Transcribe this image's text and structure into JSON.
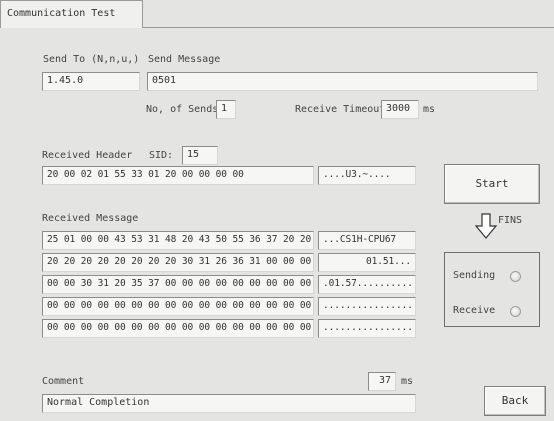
{
  "tab": {
    "label": "Communication Test"
  },
  "send_to": {
    "label": "Send To (N,n,u,)",
    "value": "1.45.0"
  },
  "send_message": {
    "label": "Send Message",
    "value": "0501"
  },
  "no_of_sends": {
    "label": "No, of Sends:",
    "value": "1"
  },
  "receive_timeout": {
    "label": "Receive Timeout",
    "value": "3000",
    "unit": "ms"
  },
  "received_header": {
    "label": "Received Header",
    "sid_label": "SID:",
    "sid_value": "15",
    "hex": "20 00 02 01 55 33 01 20 00 00 00 00",
    "ascii": "....U3.~...."
  },
  "received_message": {
    "label": "Received Message",
    "rows": [
      {
        "hex": "25 01 00 00 43 53 31 48 20 43 50 55 36 37 20 20",
        "ascii": "...CS1H-CPU67"
      },
      {
        "hex": "20 20 20 20 20 20 20 20 30 31 26 36 31 00 00 00",
        "ascii": "01.51..."
      },
      {
        "hex": "00 00 30 31 20 35 37 00 00 00 00 00 00 00 00 00",
        "ascii": ".01.57.........."
      },
      {
        "hex": "00 00 00 00 00 00 00 00 00 00 00 00 00 00 00 00",
        "ascii": "................"
      },
      {
        "hex": "00 00 00 00 00 00 00 00 00 00 00 00 00 00 00 00",
        "ascii": "................"
      }
    ]
  },
  "start_button": {
    "label": "Start"
  },
  "fins": {
    "label": "FINS",
    "icon": "down-arrow-icon"
  },
  "status": {
    "sending_label": "Sending",
    "receive_label": "Receive"
  },
  "comment": {
    "label": "Comment",
    "value": "Normal Completion",
    "time_value": "37",
    "time_unit": "ms"
  },
  "back_button": {
    "label": "Back"
  },
  "colors": {
    "background": "#e4e4e2",
    "field": "#f6f6f4",
    "border": "#8c8c8a"
  }
}
